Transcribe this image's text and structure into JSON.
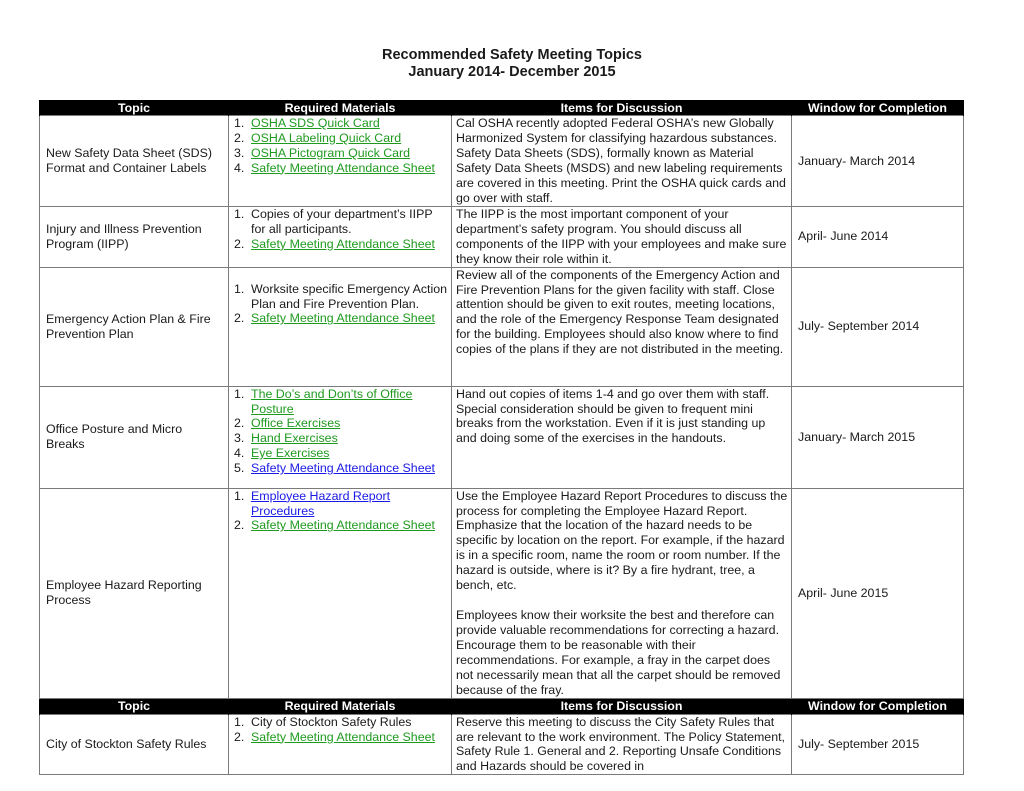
{
  "document": {
    "title_line1": "Recommended Safety Meeting Topics",
    "title_line2": "January 2014- December 2015"
  },
  "table": {
    "headers": [
      "Topic",
      "Required Materials",
      "Items for Discussion",
      "Window for Completion"
    ],
    "colors": {
      "header_bg": "#000000",
      "header_text": "#ffffff",
      "link_green": "#1f9a1f",
      "link_blue": "#1a1ae6",
      "border": "#7a7a7a"
    },
    "rows": [
      {
        "topic": "New Safety Data Sheet (SDS) Format and Container Labels",
        "materials": [
          {
            "num": "1.",
            "text": "OSHA SDS Quick Card",
            "link": "green"
          },
          {
            "num": "2.",
            "text": "OSHA Labeling Quick Card",
            "link": "green"
          },
          {
            "num": "3.",
            "text": "OSHA Pictogram Quick Card",
            "link": "green"
          },
          {
            "num": "4.",
            "text": "Safety Meeting Attendance Sheet",
            "link": "green"
          }
        ],
        "discussion": [
          "Cal OSHA recently adopted Federal OSHA’s new Globally Harmonized System for classifying hazardous substances. Safety Data Sheets (SDS), formally known as Material Safety Data Sheets (MSDS) and new labeling requirements are covered in this meeting. Print the OSHA quick cards and go over with staff."
        ],
        "window": "January- March 2014"
      },
      {
        "topic": "Injury and Illness Prevention Program (IIPP)",
        "materials": [
          {
            "num": "1.",
            "text": "Copies of your department’s IIPP for all participants.",
            "link": "none"
          },
          {
            "num": "2.",
            "text": "Safety Meeting Attendance Sheet",
            "link": "green"
          }
        ],
        "discussion": [
          "The IIPP is the most important component of your department’s safety program. You should discuss all components of the IIPP with your employees and make sure they know their role within it."
        ],
        "window": "April- June 2014"
      },
      {
        "topic": "Emergency Action Plan & Fire Prevention Plan",
        "materials": [
          {
            "num": "1.",
            "text": "Worksite specific Emergency Action Plan and Fire Prevention Plan.",
            "link": "none"
          },
          {
            "num": "2.",
            "text": "Safety Meeting Attendance Sheet",
            "link": "green"
          }
        ],
        "discussion": [
          "Review all of the components of the Emergency Action and Fire Prevention Plans for the given facility with staff. Close attention should be given to exit routes, meeting locations, and the role of the Emergency Response Team designated for the building. Employees should also know where to find copies of the plans if they are not distributed in the meeting."
        ],
        "window": "July- September 2014"
      },
      {
        "topic": "Office Posture and Micro Breaks",
        "materials": [
          {
            "num": "1.",
            "text": "The Do’s and Don’ts of Office Posture",
            "link": "green"
          },
          {
            "num": "2.",
            "text": "Office Exercises",
            "link": "green"
          },
          {
            "num": "3.",
            "text": "Hand Exercises",
            "link": "green"
          },
          {
            "num": "4.",
            "text": "Eye Exercises",
            "link": "green"
          },
          {
            "num": "5.",
            "text": "Safety Meeting Attendance Sheet",
            "link": "blue"
          }
        ],
        "discussion": [
          "Hand out copies of items 1-4 and go over them with staff. Special consideration should be given to frequent mini breaks from the workstation. Even if it is just standing up and doing some of the exercises in the handouts."
        ],
        "window": "January- March 2015"
      },
      {
        "topic": "Employee Hazard Reporting Process",
        "materials": [
          {
            "num": "1.",
            "text": "Employee Hazard Report Procedures",
            "link": "blue"
          },
          {
            "num": "2.",
            "text": "Safety Meeting Attendance Sheet",
            "link": "green"
          }
        ],
        "discussion": [
          "Use the Employee Hazard Report Procedures to discuss the process for completing the Employee Hazard Report. Emphasize that the location of the hazard needs to be specific by location on the report. For example, if the hazard is in a specific room, name the room or room number. If the hazard is outside, where is it? By a fire hydrant, tree, a bench, etc.",
          "Employees know their worksite the best and therefore can provide valuable recommendations for correcting a hazard. Encourage them to be reasonable with their recommendations. For example, a fray in the carpet does not necessarily mean that all the carpet should be removed because of the fray."
        ],
        "window": "April- June 2015"
      }
    ],
    "headers_repeat": [
      "Topic",
      "Required Materials",
      "Items for Discussion",
      "Window for Completion"
    ],
    "rows_page2": [
      {
        "topic": "City of Stockton Safety Rules",
        "materials": [
          {
            "num": "1.",
            "text": "City of Stockton Safety Rules",
            "link": "none"
          },
          {
            "num": "2.",
            "text": "Safety Meeting Attendance Sheet",
            "link": "green"
          }
        ],
        "discussion": [
          "Reserve this meeting to discuss the City Safety Rules that are relevant to the work environment. The Policy Statement, Safety Rule 1. General and 2. Reporting Unsafe Conditions and Hazards should be covered in"
        ],
        "window": "July- September 2015"
      }
    ]
  }
}
